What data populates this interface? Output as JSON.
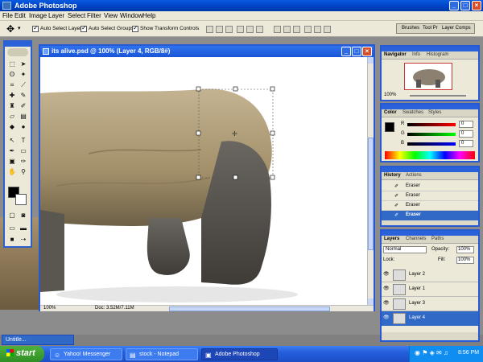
{
  "app": {
    "title": "Adobe Photoshop"
  },
  "menu": [
    "File",
    "Edit",
    "Image",
    "Layer",
    "Select",
    "Filter",
    "View",
    "Window",
    "Help"
  ],
  "options": {
    "auto_select_layer": "Auto Select Layer",
    "auto_select_groups": "Auto Select Groups",
    "show_transform_controls": "Show Transform Controls"
  },
  "palette_well": {
    "tabs": [
      "Brushes",
      "Tool Pr",
      "Layer Comps"
    ]
  },
  "document": {
    "title": "its alive.psd @ 100% (Layer 4, RGB/8#)",
    "zoom": "100%",
    "doc_size": "Doc: 3.52M/7.11M"
  },
  "navigator": {
    "tabs": [
      "Navigator",
      "Info",
      "Histogram"
    ],
    "zoom": "100%"
  },
  "color": {
    "tabs": [
      "Color",
      "Swatches",
      "Styles"
    ],
    "channels": [
      {
        "label": "R",
        "value": "0"
      },
      {
        "label": "G",
        "value": "0"
      },
      {
        "label": "B",
        "value": "0"
      }
    ]
  },
  "history": {
    "tabs": [
      "History",
      "Actions"
    ],
    "items": [
      "Eraser",
      "Eraser",
      "Eraser",
      "Eraser"
    ]
  },
  "layers": {
    "tabs": [
      "Layers",
      "Channels",
      "Paths"
    ],
    "blend_mode": "Normal",
    "opacity_label": "Opacity:",
    "opacity": "100%",
    "lock_label": "Lock:",
    "fill_label": "Fill:",
    "fill": "100%",
    "items": [
      "Layer 2",
      "Layer 1",
      "Layer 3",
      "Layer 4"
    ]
  },
  "minimized_doc": {
    "title": "Untitle..."
  },
  "taskbar": {
    "start": "start",
    "items": [
      "Yahoo! Messenger",
      "stock - Notepad",
      "Adobe Photoshop"
    ],
    "clock": "8:56 PM"
  },
  "colors": {
    "accent": "#2659d3",
    "selection": "#3169c6",
    "foreground": "#000000",
    "background": "#ffffff"
  }
}
